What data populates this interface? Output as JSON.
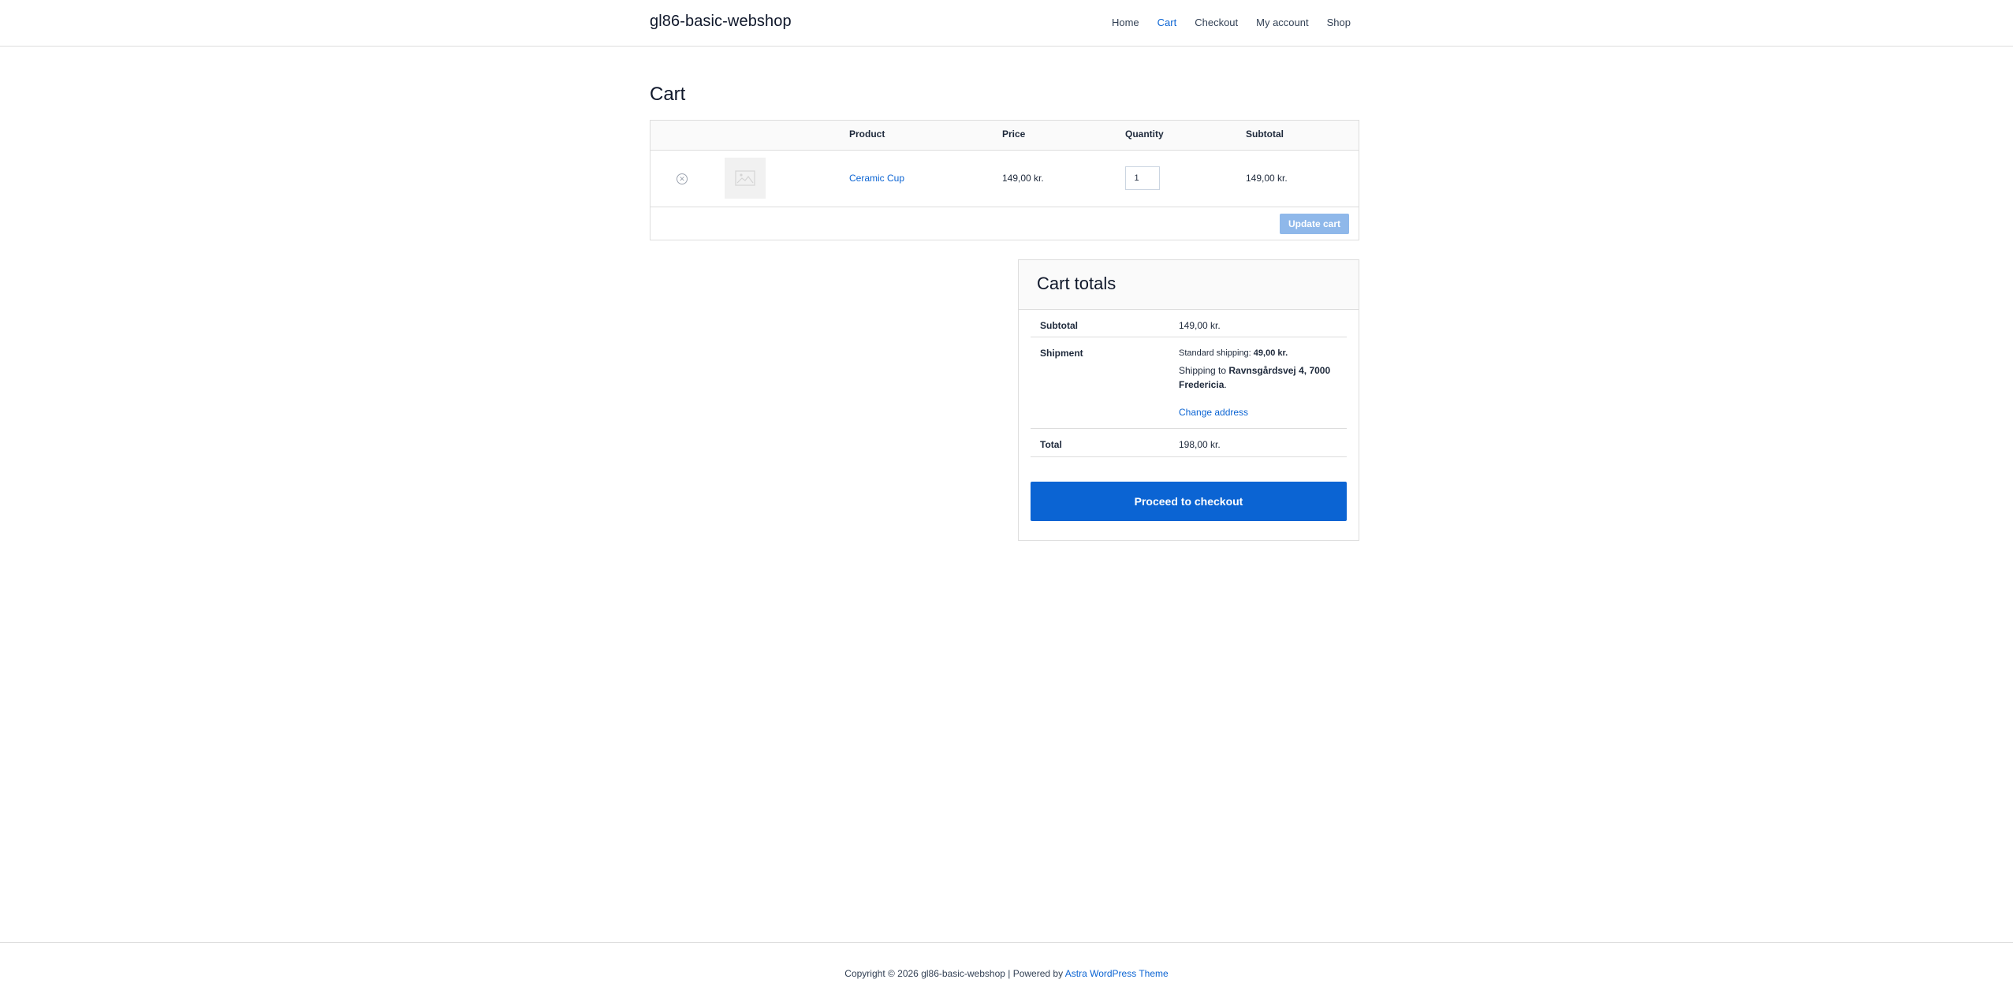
{
  "site": {
    "title": "gl86-basic-webshop"
  },
  "nav": {
    "items": [
      {
        "label": "Home"
      },
      {
        "label": "Cart"
      },
      {
        "label": "Checkout"
      },
      {
        "label": "My account"
      },
      {
        "label": "Shop"
      }
    ],
    "active": "Cart",
    "active_color": "#0b64d3"
  },
  "page": {
    "title": "Cart"
  },
  "cart": {
    "columns": {
      "product": "Product",
      "price": "Price",
      "quantity": "Quantity",
      "subtotal": "Subtotal"
    },
    "items": [
      {
        "name": "Ceramic Cup",
        "price": "149,00 kr.",
        "quantity": "1",
        "subtotal": "149,00 kr.",
        "thumbnail_icon": "image-placeholder-icon",
        "remove_icon": "remove-circle-icon"
      }
    ],
    "update_label": "Update cart"
  },
  "totals": {
    "title": "Cart totals",
    "subtotal_label": "Subtotal",
    "subtotal_value": "149,00 kr.",
    "shipment_label": "Shipment",
    "shipping_method_label": "Standard shipping:",
    "shipping_method_price": "49,00 kr.",
    "shipping_to_label": "Shipping to",
    "shipping_address": "Ravnsgårdsvej 4, 7000 Fredericia",
    "shipping_address_suffix": ".",
    "change_address_label": "Change address",
    "total_label": "Total",
    "total_value": "198,00 kr.",
    "checkout_label": "Proceed to checkout"
  },
  "footer": {
    "copyright": "Copyright © 2026 gl86-basic-webshop | Powered by",
    "theme_link": "Astra WordPress Theme"
  },
  "colors": {
    "accent": "#0b64d3",
    "update_button": "#8fb8ea",
    "border": "#dddddd"
  }
}
